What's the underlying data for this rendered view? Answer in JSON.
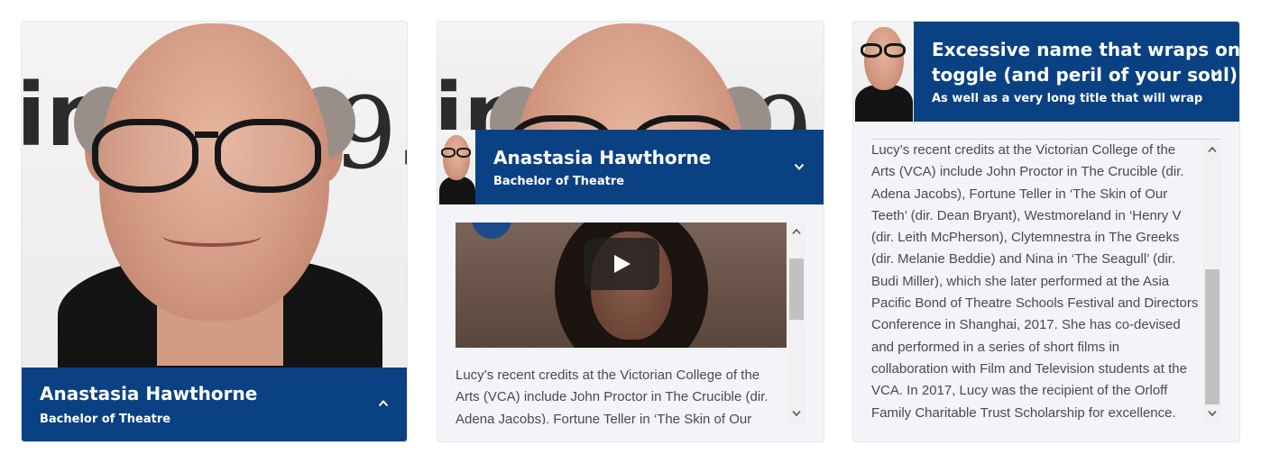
{
  "cards": [
    {
      "name": "Anastasia Hawthorne",
      "title": "Bachelor of Theatre",
      "toggle_icon": "chevron-up-icon",
      "state": "collapsed"
    },
    {
      "name": "Anastasia Hawthorne",
      "title": "Bachelor of Theatre",
      "toggle_icon": "chevron-down-icon",
      "video_icon": "play-icon",
      "bio_lines": [
        "Lucy’s recent credits at the Victorian College of the",
        "Arts (VCA) include John Proctor in The Crucible (dir.",
        "Adena Jacobs). Fortune Teller in ‘The Skin of Our"
      ]
    },
    {
      "name_lines": [
        "Excessive name that wraps on",
        "toggle (and peril of your soul)"
      ],
      "title": "As well as a very long title that will wrap",
      "toggle_icon": "chevron-down-icon",
      "bio_lines": [
        "Lucy’s recent credits at the Victorian College of the",
        "Arts (VCA) include John Proctor in The Crucible (dir.",
        "Adena Jacobs), Fortune Teller in ‘The Skin of Our",
        "Teeth’ (dir. Dean Bryant), Westmoreland in ‘Henry V",
        "(dir. Leith McPherson), Clytemnestra in The Greeks",
        "(dir. Melanie Beddie) and Nina in ‘The Seagull’ (dir.",
        "Budi Miller), which she later performed at the Asia",
        "Pacific Bond of Theatre Schools Festival and Directors",
        "Conference in Shanghai, 2017. She has co-devised",
        "and performed in a series of short films in",
        "collaboration with Film and Television students at the",
        "VCA. In 2017, Lucy was the recipient of the Orloff",
        "Family Charitable Trust Scholarship for excellence."
      ]
    }
  ],
  "colors": {
    "banner": "#094183",
    "card_bg": "#f2f4f7",
    "text": "#4a4a4a"
  }
}
